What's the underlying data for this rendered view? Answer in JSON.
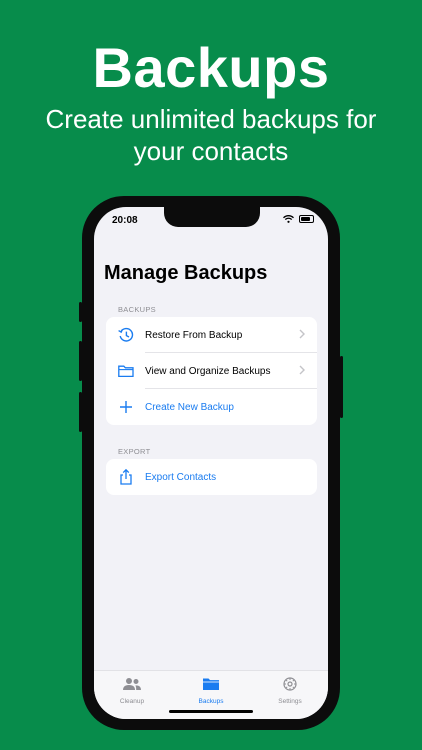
{
  "hero": {
    "title": "Backups",
    "subtitle_line1": "Create unlimited backups for",
    "subtitle_line2": "your contacts"
  },
  "status_bar": {
    "time": "20:08"
  },
  "page_title": "Manage Backups",
  "sections": {
    "backups_header": "BACKUPS",
    "backups_items": [
      {
        "label": "Restore From Backup",
        "icon": "restore-clock-icon"
      },
      {
        "label": "View and Organize Backups",
        "icon": "folder-icon"
      },
      {
        "label": "Create New Backup",
        "icon": "plus-icon"
      }
    ],
    "export_header": "EXPORT",
    "export_items": [
      {
        "label": "Export Contacts",
        "icon": "share-icon"
      }
    ]
  },
  "tabbar": {
    "tabs": [
      {
        "label": "Cleanup",
        "icon": "people-icon"
      },
      {
        "label": "Backups",
        "icon": "folder-fill-icon"
      },
      {
        "label": "Settings",
        "icon": "gear-icon"
      }
    ],
    "active_tab": "Backups"
  },
  "colors": {
    "background": "#078c4b",
    "accent": "#1a7cf0",
    "screen_bg": "#f2f2f7"
  }
}
